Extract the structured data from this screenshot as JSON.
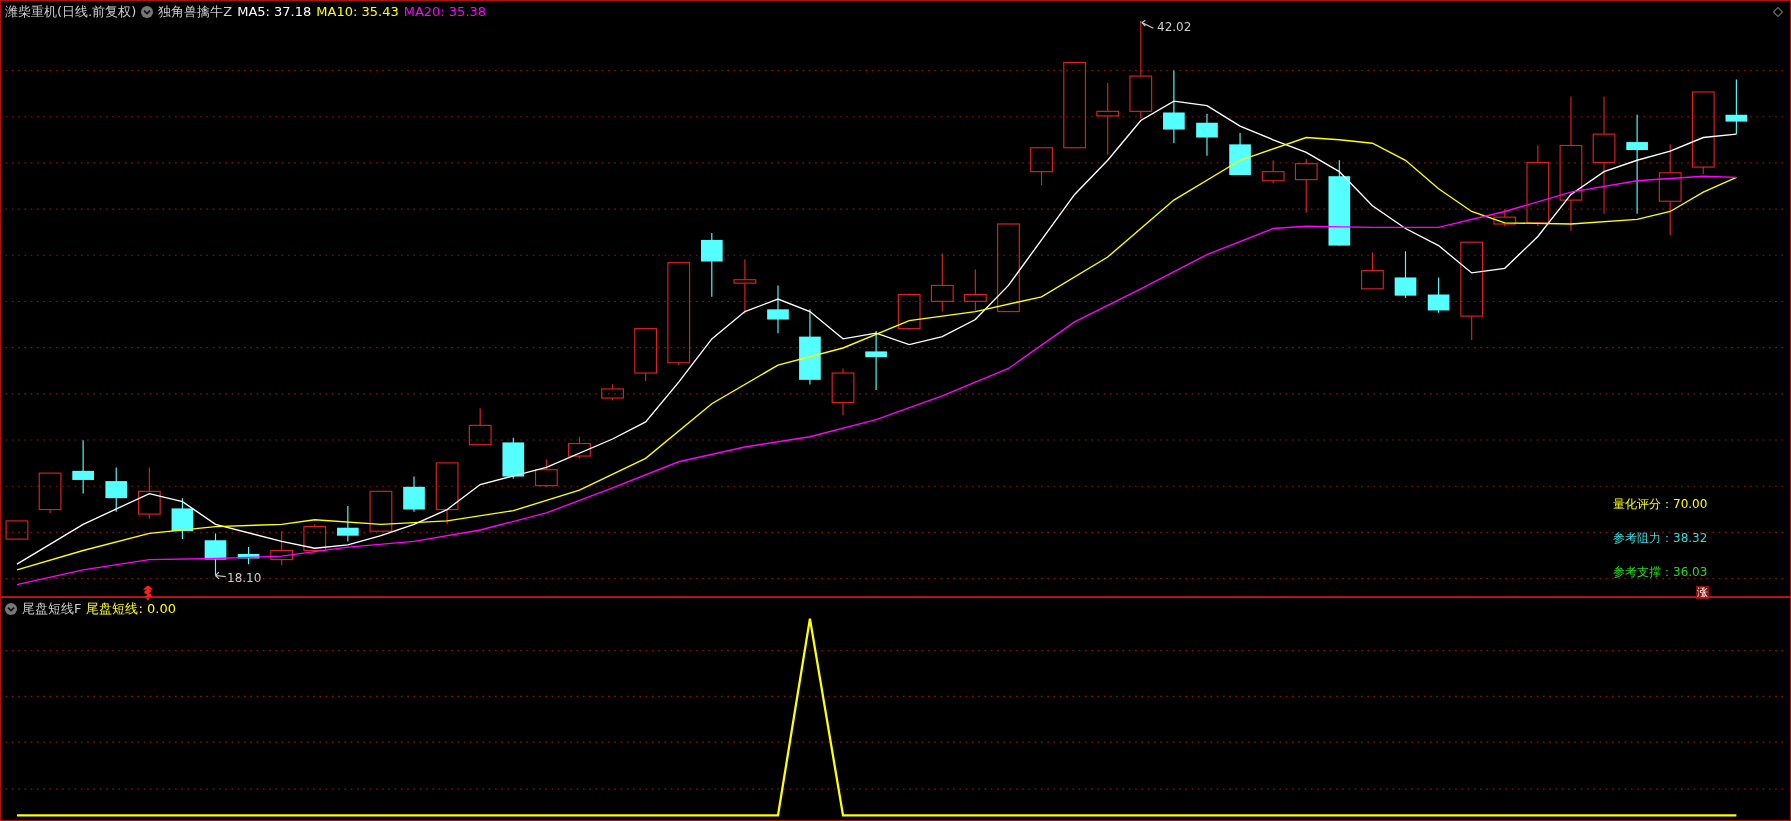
{
  "header": {
    "title": "潍柴重机(日线.前复权)",
    "indicator": "独角兽擒牛Z",
    "moving_averages": [
      {
        "label": "MA5: 37.18",
        "color": "#ffffff"
      },
      {
        "label": "MA10: 35.43",
        "color": "#ffff00"
      },
      {
        "label": "MA20: 35.38",
        "color": "#ff00ff"
      }
    ]
  },
  "price_labels": [
    {
      "kind": "high",
      "text": "42.02"
    },
    {
      "kind": "low",
      "text": "18.10"
    }
  ],
  "stats": [
    {
      "label": "量化评分：70.00",
      "color": "#ffff00"
    },
    {
      "label": "参考阻力：38.32",
      "color": "#33dddd"
    },
    {
      "label": "参考支撑：36.03",
      "color": "#22dd22"
    }
  ],
  "signals": [
    {
      "kind": "buy"
    },
    {
      "kind": "rise",
      "text": "涨"
    }
  ],
  "sub_panel": {
    "title": "尾盘短线F",
    "legend": "尾盘短线: 0.00"
  }
}
